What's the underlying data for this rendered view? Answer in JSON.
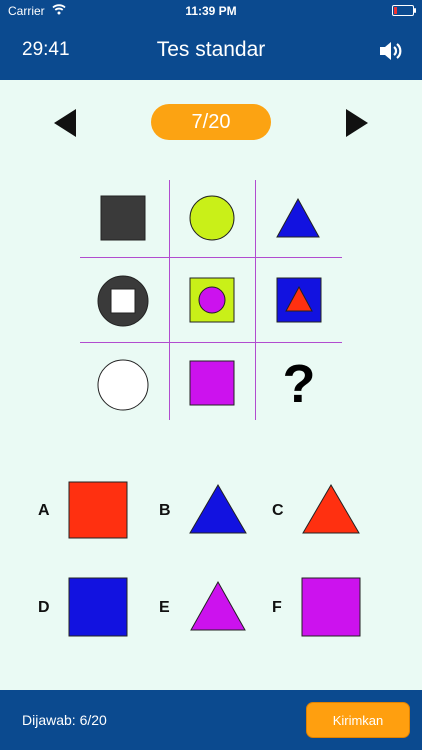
{
  "status_bar": {
    "carrier": "Carrier",
    "time": "11:39 PM"
  },
  "header": {
    "timer": "29:41",
    "title": "Tes standar"
  },
  "pager": {
    "label": "7/20"
  },
  "puzzle": {
    "question_mark": "?",
    "cells": [
      {
        "shape": "square",
        "fill": "#3a3a3a"
      },
      {
        "shape": "circle",
        "fill": "#c9f018"
      },
      {
        "shape": "triangle",
        "fill": "#1212e0"
      },
      {
        "shape": "circle-with-square",
        "outer": "#3a3a3a",
        "inner": "#ffffff"
      },
      {
        "shape": "square-with-circle",
        "outer": "#c9f018",
        "inner": "#cc12ee"
      },
      {
        "shape": "square-with-triangle",
        "outer": "#1212e0",
        "inner": "#ff3010"
      },
      {
        "shape": "circle",
        "fill": "#ffffff"
      },
      {
        "shape": "square",
        "fill": "#cc12ee"
      },
      {
        "shape": "question-mark"
      }
    ]
  },
  "options": [
    {
      "letter": "A",
      "shape": "square",
      "fill": "#ff3010"
    },
    {
      "letter": "B",
      "shape": "triangle",
      "fill": "#1212e0"
    },
    {
      "letter": "C",
      "shape": "triangle",
      "fill": "#ff3010"
    },
    {
      "letter": "D",
      "shape": "square",
      "fill": "#1212e0"
    },
    {
      "letter": "E",
      "shape": "triangle",
      "fill": "#cc12ee"
    },
    {
      "letter": "F",
      "shape": "square",
      "fill": "#cc12ee"
    }
  ],
  "footer": {
    "answered": "Dijawab: 6/20",
    "submit_label": "Kirimkan"
  },
  "colors": {
    "primary": "#0b4a8f",
    "accent": "#fca312",
    "background": "#eafaf4",
    "grid_line": "#b14ccf"
  }
}
